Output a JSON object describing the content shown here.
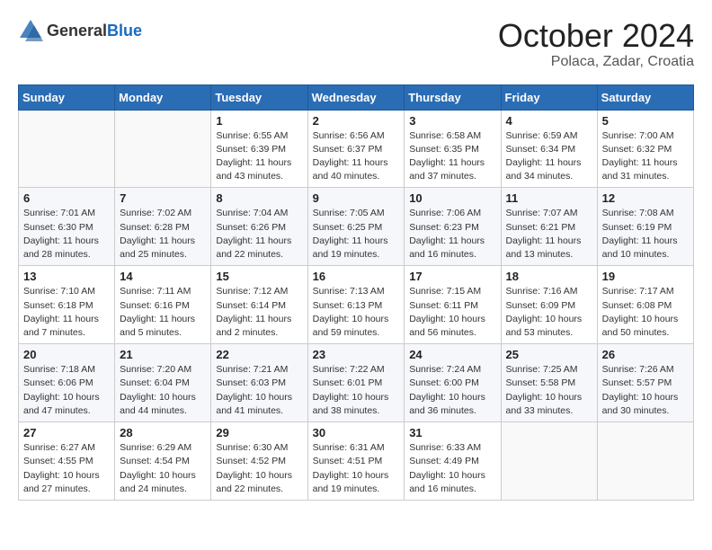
{
  "header": {
    "logo_general": "General",
    "logo_blue": "Blue",
    "month": "October 2024",
    "location": "Polaca, Zadar, Croatia"
  },
  "weekdays": [
    "Sunday",
    "Monday",
    "Tuesday",
    "Wednesday",
    "Thursday",
    "Friday",
    "Saturday"
  ],
  "weeks": [
    [
      null,
      null,
      {
        "day": "1",
        "sunrise": "Sunrise: 6:55 AM",
        "sunset": "Sunset: 6:39 PM",
        "daylight": "Daylight: 11 hours and 43 minutes."
      },
      {
        "day": "2",
        "sunrise": "Sunrise: 6:56 AM",
        "sunset": "Sunset: 6:37 PM",
        "daylight": "Daylight: 11 hours and 40 minutes."
      },
      {
        "day": "3",
        "sunrise": "Sunrise: 6:58 AM",
        "sunset": "Sunset: 6:35 PM",
        "daylight": "Daylight: 11 hours and 37 minutes."
      },
      {
        "day": "4",
        "sunrise": "Sunrise: 6:59 AM",
        "sunset": "Sunset: 6:34 PM",
        "daylight": "Daylight: 11 hours and 34 minutes."
      },
      {
        "day": "5",
        "sunrise": "Sunrise: 7:00 AM",
        "sunset": "Sunset: 6:32 PM",
        "daylight": "Daylight: 11 hours and 31 minutes."
      }
    ],
    [
      {
        "day": "6",
        "sunrise": "Sunrise: 7:01 AM",
        "sunset": "Sunset: 6:30 PM",
        "daylight": "Daylight: 11 hours and 28 minutes."
      },
      {
        "day": "7",
        "sunrise": "Sunrise: 7:02 AM",
        "sunset": "Sunset: 6:28 PM",
        "daylight": "Daylight: 11 hours and 25 minutes."
      },
      {
        "day": "8",
        "sunrise": "Sunrise: 7:04 AM",
        "sunset": "Sunset: 6:26 PM",
        "daylight": "Daylight: 11 hours and 22 minutes."
      },
      {
        "day": "9",
        "sunrise": "Sunrise: 7:05 AM",
        "sunset": "Sunset: 6:25 PM",
        "daylight": "Daylight: 11 hours and 19 minutes."
      },
      {
        "day": "10",
        "sunrise": "Sunrise: 7:06 AM",
        "sunset": "Sunset: 6:23 PM",
        "daylight": "Daylight: 11 hours and 16 minutes."
      },
      {
        "day": "11",
        "sunrise": "Sunrise: 7:07 AM",
        "sunset": "Sunset: 6:21 PM",
        "daylight": "Daylight: 11 hours and 13 minutes."
      },
      {
        "day": "12",
        "sunrise": "Sunrise: 7:08 AM",
        "sunset": "Sunset: 6:19 PM",
        "daylight": "Daylight: 11 hours and 10 minutes."
      }
    ],
    [
      {
        "day": "13",
        "sunrise": "Sunrise: 7:10 AM",
        "sunset": "Sunset: 6:18 PM",
        "daylight": "Daylight: 11 hours and 7 minutes."
      },
      {
        "day": "14",
        "sunrise": "Sunrise: 7:11 AM",
        "sunset": "Sunset: 6:16 PM",
        "daylight": "Daylight: 11 hours and 5 minutes."
      },
      {
        "day": "15",
        "sunrise": "Sunrise: 7:12 AM",
        "sunset": "Sunset: 6:14 PM",
        "daylight": "Daylight: 11 hours and 2 minutes."
      },
      {
        "day": "16",
        "sunrise": "Sunrise: 7:13 AM",
        "sunset": "Sunset: 6:13 PM",
        "daylight": "Daylight: 10 hours and 59 minutes."
      },
      {
        "day": "17",
        "sunrise": "Sunrise: 7:15 AM",
        "sunset": "Sunset: 6:11 PM",
        "daylight": "Daylight: 10 hours and 56 minutes."
      },
      {
        "day": "18",
        "sunrise": "Sunrise: 7:16 AM",
        "sunset": "Sunset: 6:09 PM",
        "daylight": "Daylight: 10 hours and 53 minutes."
      },
      {
        "day": "19",
        "sunrise": "Sunrise: 7:17 AM",
        "sunset": "Sunset: 6:08 PM",
        "daylight": "Daylight: 10 hours and 50 minutes."
      }
    ],
    [
      {
        "day": "20",
        "sunrise": "Sunrise: 7:18 AM",
        "sunset": "Sunset: 6:06 PM",
        "daylight": "Daylight: 10 hours and 47 minutes."
      },
      {
        "day": "21",
        "sunrise": "Sunrise: 7:20 AM",
        "sunset": "Sunset: 6:04 PM",
        "daylight": "Daylight: 10 hours and 44 minutes."
      },
      {
        "day": "22",
        "sunrise": "Sunrise: 7:21 AM",
        "sunset": "Sunset: 6:03 PM",
        "daylight": "Daylight: 10 hours and 41 minutes."
      },
      {
        "day": "23",
        "sunrise": "Sunrise: 7:22 AM",
        "sunset": "Sunset: 6:01 PM",
        "daylight": "Daylight: 10 hours and 38 minutes."
      },
      {
        "day": "24",
        "sunrise": "Sunrise: 7:24 AM",
        "sunset": "Sunset: 6:00 PM",
        "daylight": "Daylight: 10 hours and 36 minutes."
      },
      {
        "day": "25",
        "sunrise": "Sunrise: 7:25 AM",
        "sunset": "Sunset: 5:58 PM",
        "daylight": "Daylight: 10 hours and 33 minutes."
      },
      {
        "day": "26",
        "sunrise": "Sunrise: 7:26 AM",
        "sunset": "Sunset: 5:57 PM",
        "daylight": "Daylight: 10 hours and 30 minutes."
      }
    ],
    [
      {
        "day": "27",
        "sunrise": "Sunrise: 6:27 AM",
        "sunset": "Sunset: 4:55 PM",
        "daylight": "Daylight: 10 hours and 27 minutes."
      },
      {
        "day": "28",
        "sunrise": "Sunrise: 6:29 AM",
        "sunset": "Sunset: 4:54 PM",
        "daylight": "Daylight: 10 hours and 24 minutes."
      },
      {
        "day": "29",
        "sunrise": "Sunrise: 6:30 AM",
        "sunset": "Sunset: 4:52 PM",
        "daylight": "Daylight: 10 hours and 22 minutes."
      },
      {
        "day": "30",
        "sunrise": "Sunrise: 6:31 AM",
        "sunset": "Sunset: 4:51 PM",
        "daylight": "Daylight: 10 hours and 19 minutes."
      },
      {
        "day": "31",
        "sunrise": "Sunrise: 6:33 AM",
        "sunset": "Sunset: 4:49 PM",
        "daylight": "Daylight: 10 hours and 16 minutes."
      },
      null,
      null
    ]
  ]
}
